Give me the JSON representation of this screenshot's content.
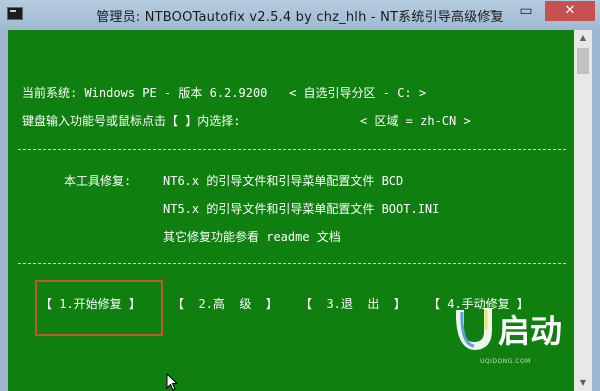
{
  "window": {
    "title": "管理员:  NTBOOTautofix v2.5.4 by chz_hlh - NT系统引导高级修复",
    "buttons": {
      "minimize": "–",
      "maximize": "▭",
      "close": "✕"
    }
  },
  "console": {
    "line_system": "当前系统: Windows PE - 版本 6.2.9200   < 自选引导分区 - C: >",
    "line_prompt": "键盘输入功能号或鼠标点击【 】内选择:",
    "line_locale": "< 区域 = zh-CN >",
    "repair_label": "本工具修复:",
    "repair_nt6": "NT6.x 的引导文件和引导菜单配置文件 BCD",
    "repair_nt5": "NT5.x 的引导文件和引导菜单配置文件 BOOT.INI",
    "repair_other": "其它修复功能参看 readme 文档"
  },
  "menu": [
    {
      "label": "【 1.开始修复 】"
    },
    {
      "label": "【  2.高  级  】"
    },
    {
      "label": "【  3.退  出  】"
    },
    {
      "label": "【 4.手动修复 】"
    }
  ],
  "watermark": {
    "text": "启动",
    "url": "UQIDONG.COM"
  },
  "colors": {
    "console_bg": "#0f7f0f",
    "console_fg": "#ffffff",
    "highlight": "#c2572f"
  }
}
